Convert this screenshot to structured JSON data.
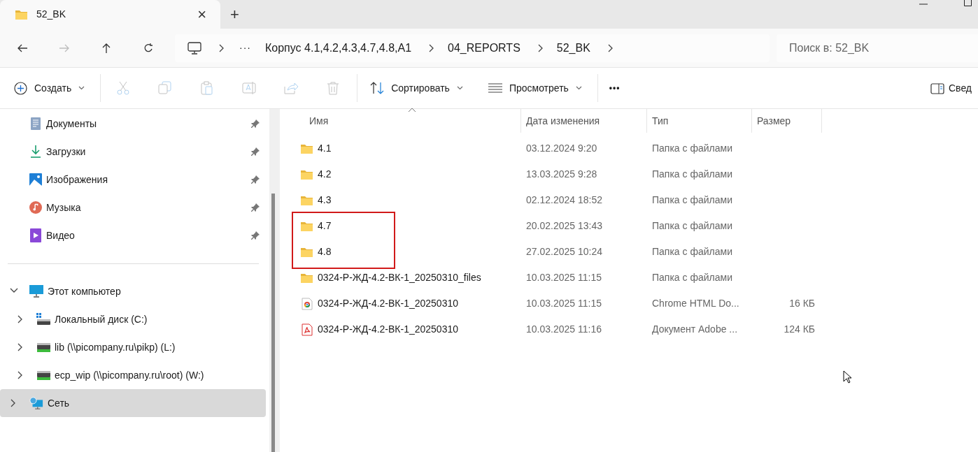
{
  "window": {
    "tab_title": "52_BK",
    "tab_close": "×",
    "new_tab": "+"
  },
  "address_bar": {
    "overflow": "···",
    "segments": [
      "Корпус 4.1,4.2,4.3,4.7,4.8,A1",
      "04_REPORTS",
      "52_BK"
    ],
    "forward_disabled": true
  },
  "search": {
    "placeholder": "Поиск в: 52_BK"
  },
  "toolbar": {
    "create": "Создать",
    "actions": [
      {
        "kind": "cut",
        "disabled": true
      },
      {
        "kind": "copy",
        "disabled": true
      },
      {
        "kind": "paste",
        "disabled": true
      },
      {
        "kind": "rename",
        "disabled": true
      },
      {
        "kind": "share",
        "disabled": true
      },
      {
        "kind": "delete",
        "disabled": true
      }
    ],
    "sort": "Сортировать",
    "view": "Просмотреть",
    "more": "•••",
    "details": "Свед"
  },
  "sidebar": {
    "quick_access": [
      {
        "label": "Документы",
        "kind": "documents",
        "pinned": true
      },
      {
        "label": "Загрузки",
        "kind": "downloads",
        "pinned": true
      },
      {
        "label": "Изображения",
        "kind": "pictures",
        "pinned": true
      },
      {
        "label": "Музыка",
        "kind": "music",
        "pinned": true
      },
      {
        "label": "Видео",
        "kind": "videos",
        "pinned": true
      }
    ],
    "tree": [
      {
        "label": "Этот компьютер",
        "kind": "computer",
        "expanded": true,
        "selected": false,
        "children": [
          {
            "label": "Локальный диск (C:)",
            "kind": "system-drive",
            "expanded": false,
            "selected": false
          },
          {
            "label": "lib (\\\\picompany.ru\\pikp) (L:)",
            "kind": "network-drive",
            "expanded": false,
            "selected": false
          },
          {
            "label": "ecp_wip (\\\\picompany.ru\\root) (W:)",
            "kind": "network-drive",
            "expanded": false,
            "selected": false
          }
        ]
      },
      {
        "label": "Сеть",
        "kind": "network",
        "expanded": false,
        "selected": true
      }
    ]
  },
  "table": {
    "columns": [
      "Имя",
      "Дата изменения",
      "Тип",
      "Размер"
    ],
    "rows": [
      {
        "name": "4.1",
        "kind": "folder",
        "modified": "03.12.2024 9:20",
        "type": "Папка с файлами",
        "highlighted": false
      },
      {
        "name": "4.2",
        "kind": "folder",
        "modified": "13.03.2025 9:28",
        "type": "Папка с файлами",
        "highlighted": false
      },
      {
        "name": "4.3",
        "kind": "folder",
        "modified": "02.12.2024 18:52",
        "type": "Папка с файлами",
        "highlighted": false
      },
      {
        "name": "4.7",
        "kind": "folder",
        "modified": "20.02.2025 13:43",
        "type": "Папка с файлами",
        "highlighted": true
      },
      {
        "name": "4.8",
        "kind": "folder",
        "modified": "27.02.2025 10:24",
        "type": "Папка с файлами",
        "highlighted": true
      },
      {
        "name": "0324-Р-ЖД-4.2-ВК-1_20250310_files",
        "kind": "folder",
        "modified": "10.03.2025 11:15",
        "type": "Папка с файлами",
        "highlighted": false
      },
      {
        "name": "0324-Р-ЖД-4.2-ВК-1_20250310",
        "kind": "chrome-html",
        "modified": "10.03.2025 11:15",
        "type": "Chrome HTML Do...",
        "size": "16 КБ",
        "highlighted": false
      },
      {
        "name": "0324-Р-ЖД-4.2-ВК-1_20250310",
        "kind": "pdf",
        "modified": "10.03.2025 11:16",
        "type": "Документ Adobe ...",
        "size": "124 КБ",
        "highlighted": false
      }
    ]
  }
}
